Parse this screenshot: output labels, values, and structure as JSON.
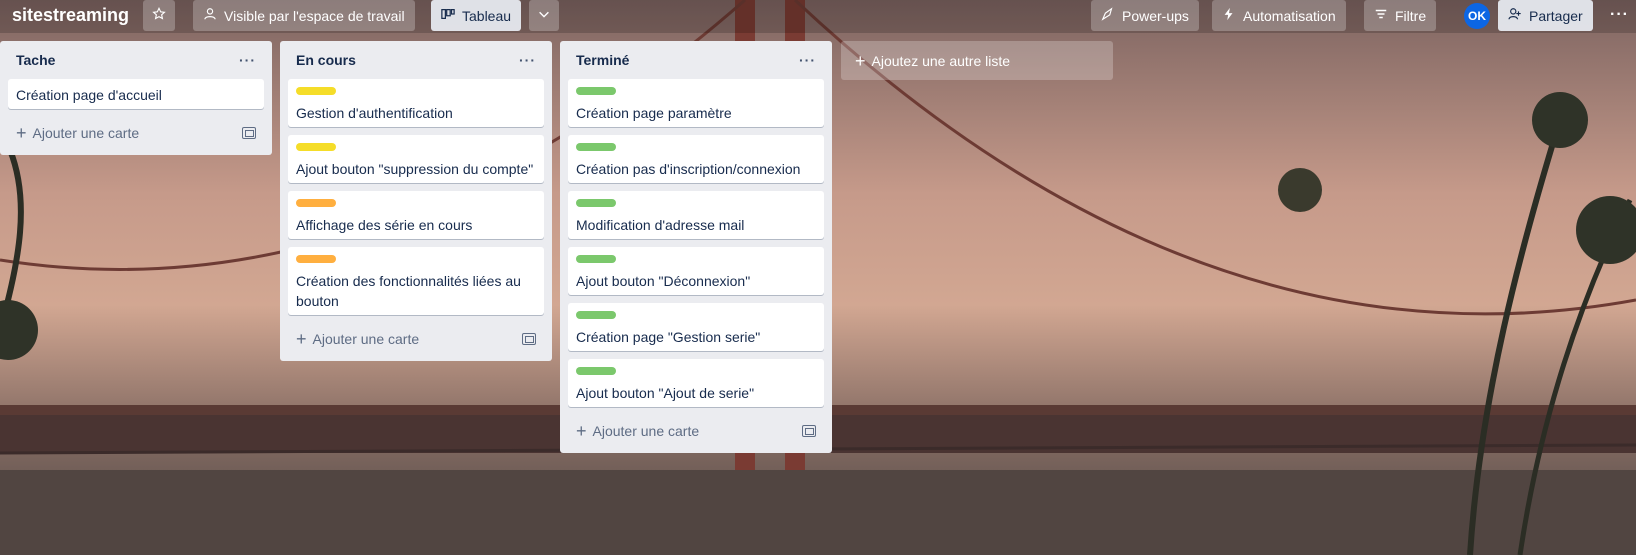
{
  "header": {
    "board_title": "sitestreaming",
    "visibility_label": "Visible par l'espace de travail",
    "view_label": "Tableau",
    "powerups_label": "Power-ups",
    "automation_label": "Automatisation",
    "filter_label": "Filtre",
    "avatar_initials": "OK",
    "share_label": "Partager"
  },
  "lists": [
    {
      "title": "Tache",
      "cards": [
        {
          "text": "Création page d'accueil"
        }
      ],
      "add_card_label": "Ajouter une carte"
    },
    {
      "title": "En cours",
      "cards": [
        {
          "label_color": "#f5dd29",
          "text": "Gestion d'authentification"
        },
        {
          "label_color": "#f5dd29",
          "text": "Ajout bouton \"suppression du compte\""
        },
        {
          "label_color": "#ffaf3f",
          "text": "Affichage des série en cours"
        },
        {
          "label_color": "#ffaf3f",
          "text": "Création des fonctionnalités liées au bouton"
        }
      ],
      "add_card_label": "Ajouter une carte"
    },
    {
      "title": "Terminé",
      "cards": [
        {
          "label_color": "#7bc86c",
          "text": "Création page paramètre"
        },
        {
          "label_color": "#7bc86c",
          "text": "Création pas d'inscription/connexion"
        },
        {
          "label_color": "#7bc86c",
          "text": "Modification d'adresse mail"
        },
        {
          "label_color": "#7bc86c",
          "text": "Ajout bouton \"Déconnexion\""
        },
        {
          "label_color": "#7bc86c",
          "text": "Création page \"Gestion serie\""
        },
        {
          "label_color": "#7bc86c",
          "text": "Ajout bouton \"Ajout de serie\""
        }
      ],
      "add_card_label": "Ajouter une carte"
    }
  ],
  "add_list_label": "Ajoutez une autre liste"
}
